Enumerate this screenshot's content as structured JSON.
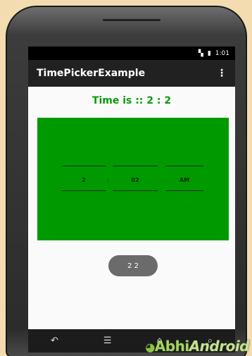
{
  "status_bar": {
    "time": "1:01",
    "signal_icon": "signal-icon",
    "battery_icon": "battery-icon"
  },
  "app_bar": {
    "title": "TimePickerExample",
    "overflow_icon": "more-vert-icon"
  },
  "main": {
    "time_text": "Time is :: 2 : 2",
    "picker": {
      "hour": {
        "prev": "1",
        "selected": "2",
        "next": "3"
      },
      "minute": {
        "prev": "01",
        "selected": "02",
        "next": "03"
      },
      "ampm": {
        "prev": "",
        "selected": "AM",
        "next": "PM"
      }
    },
    "button_label": "2 2"
  },
  "nav_bar": [
    "back-icon",
    "menu-icon",
    "home-icon",
    "search-icon"
  ],
  "watermark": {
    "part1": "Abhi",
    "part2": "Android"
  },
  "colors": {
    "picker_bg": "#009a00",
    "time_text": "#0a9a0a",
    "app_bar": "#212121"
  }
}
